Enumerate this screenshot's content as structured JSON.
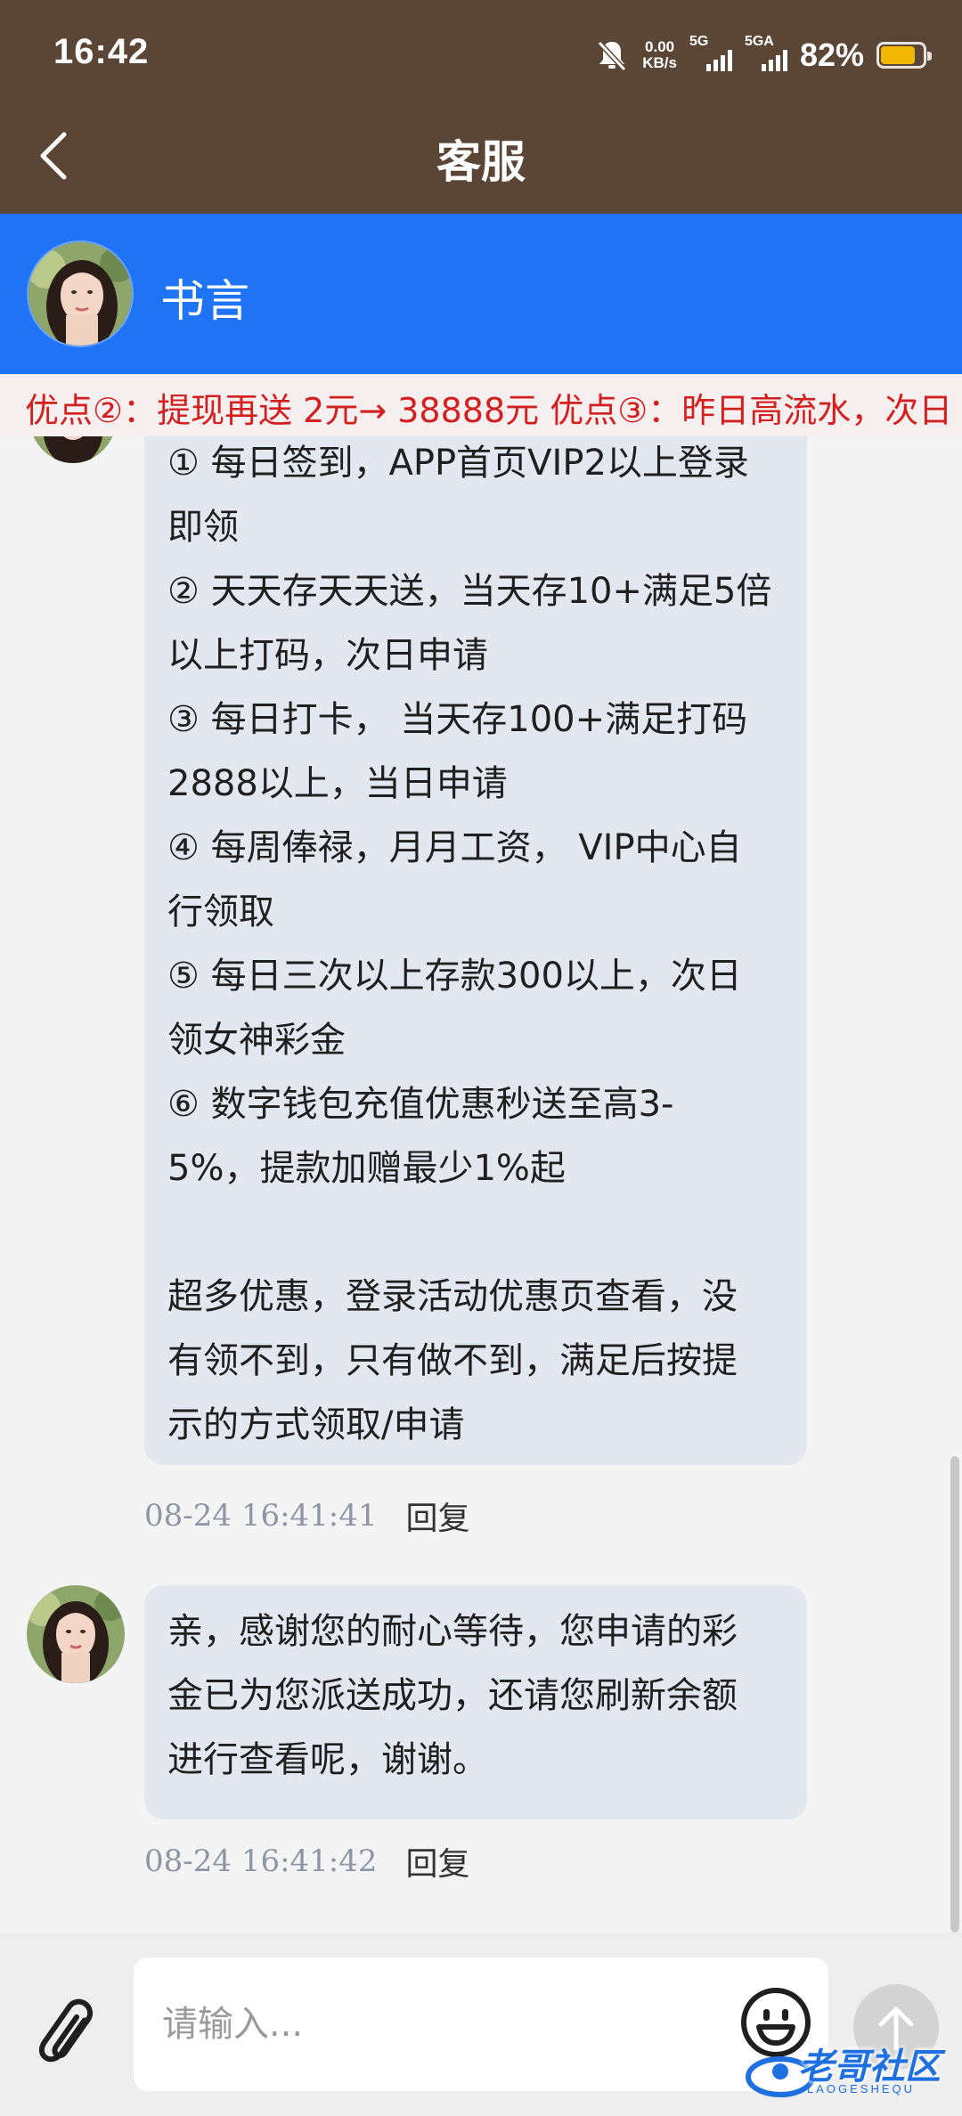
{
  "status_bar": {
    "time": "16:42",
    "speed_value": "0.00",
    "speed_unit": "KB/s",
    "sim1_label": "5G",
    "sim2_label": "5GA",
    "battery_percent_text": "82%",
    "battery_level": 0.82
  },
  "header": {
    "title": "客服"
  },
  "agent": {
    "name": "书言"
  },
  "marquee": {
    "text": "优点②：提现再送 2元→ 38888元 优点③：昨日高流水，次日"
  },
  "messages": [
    {
      "lines": [
        "① 每日签到，APP首页VIP2以上登录",
        "即领",
        "② 天天存天天送，当天存10+满足5倍",
        "以上打码，次日申请",
        "③ 每日打卡， 当天存100+满足打码",
        "2888以上，当日申请",
        "④ 每周俸禄，月月工资， VIP中心自",
        "行领取",
        "⑤ 每日三次以上存款300以上，次日",
        "领女神彩金",
        "⑥ 数字钱包充值优惠秒送至高3-",
        "5%，提款加赠最少1%起",
        "",
        "超多优惠，登录活动优惠页查看，没",
        "有领不到，只有做不到，满足后按提",
        "示的方式领取/申请"
      ],
      "timestamp": "08-24 16:41:41",
      "reply_label": "回复"
    },
    {
      "lines": [
        "亲，感谢您的耐心等待，您申请的彩",
        "金已为您派送成功，还请您刷新余额",
        "进行查看呢，谢谢。"
      ],
      "timestamp": "08-24 16:41:42",
      "reply_label": "回复"
    }
  ],
  "composer": {
    "placeholder": "请输入..."
  },
  "watermark": {
    "text": "老哥社区",
    "sub": "LAOGESHEQU"
  },
  "colors": {
    "topbar": "#5b4636",
    "agent_header": "#1f73f5",
    "marquee_text": "#d41f1f",
    "bubble": "#e3e7ef",
    "battery": "#f2b705"
  }
}
